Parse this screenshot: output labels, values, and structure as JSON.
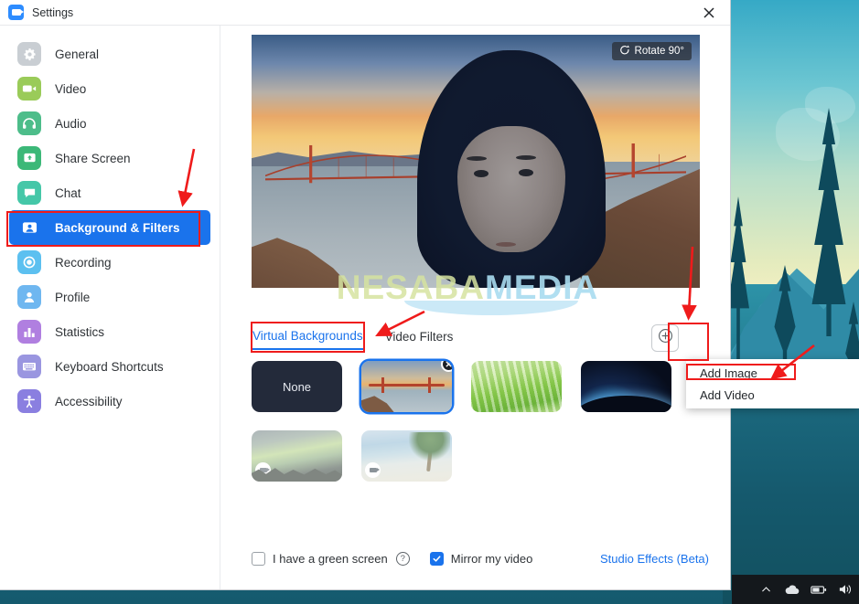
{
  "window": {
    "title": "Settings",
    "logo_icon": "zoom-logo-icon",
    "close_icon": "close-icon"
  },
  "sidebar": {
    "items": [
      {
        "label": "General",
        "icon": "gear-icon",
        "color": "#c9ced3",
        "active": false
      },
      {
        "label": "Video",
        "icon": "video-camera-icon",
        "color": "#9acb59",
        "active": false
      },
      {
        "label": "Audio",
        "icon": "headphones-icon",
        "color": "#4dbd8a",
        "active": false
      },
      {
        "label": "Share Screen",
        "icon": "share-screen-icon",
        "color": "#3cb878",
        "active": false
      },
      {
        "label": "Chat",
        "icon": "chat-bubble-icon",
        "color": "#45c7a8",
        "active": false
      },
      {
        "label": "Background & Filters",
        "icon": "person-card-icon",
        "color": "#1a73ec",
        "active": true
      },
      {
        "label": "Recording",
        "icon": "record-icon",
        "color": "#5cc0f0",
        "active": false
      },
      {
        "label": "Profile",
        "icon": "profile-icon",
        "color": "#6fb7f0",
        "active": false
      },
      {
        "label": "Statistics",
        "icon": "bar-chart-icon",
        "color": "#b07fe0",
        "active": false
      },
      {
        "label": "Keyboard Shortcuts",
        "icon": "keyboard-icon",
        "color": "#9a96e0",
        "active": false
      },
      {
        "label": "Accessibility",
        "icon": "accessibility-icon",
        "color": "#8a7fe0",
        "active": false
      }
    ]
  },
  "preview": {
    "rotate_label": "Rotate 90°",
    "rotate_icon": "rotate-icon",
    "watermark_part1": "NESABA",
    "watermark_part2": "MEDIA"
  },
  "tabs": [
    {
      "label": "Virtual Backgrounds",
      "active": true
    },
    {
      "label": "Video Filters",
      "active": false
    }
  ],
  "add_button": {
    "icon": "plus-circle-icon"
  },
  "add_menu": {
    "items": [
      {
        "label": "Add Image"
      },
      {
        "label": "Add Video"
      }
    ]
  },
  "backgrounds": [
    {
      "name": "None",
      "kind": "none",
      "selected": false,
      "removable": false,
      "video": false
    },
    {
      "name": "Golden Gate Bridge",
      "kind": "bridge",
      "selected": true,
      "removable": true,
      "video": false
    },
    {
      "name": "Grass",
      "kind": "grass",
      "selected": false,
      "removable": false,
      "video": false
    },
    {
      "name": "Earth From Space",
      "kind": "space",
      "selected": false,
      "removable": false,
      "video": false
    },
    {
      "name": "Aurora Forest",
      "kind": "aurora",
      "selected": false,
      "removable": false,
      "video": true
    },
    {
      "name": "Tropical Beach",
      "kind": "beach",
      "selected": false,
      "removable": false,
      "video": true
    }
  ],
  "bottom": {
    "green_screen_label": "I have a green screen",
    "green_screen_checked": false,
    "help_icon": "question-mark-icon",
    "mirror_label": "Mirror my video",
    "mirror_checked": true,
    "studio_effects_label": "Studio Effects (Beta)"
  },
  "taskbar": {
    "icons": [
      "chevron-up-icon",
      "onedrive-cloud-icon",
      "battery-icon",
      "speaker-icon"
    ]
  },
  "annotation_color": "#ef1b1b"
}
